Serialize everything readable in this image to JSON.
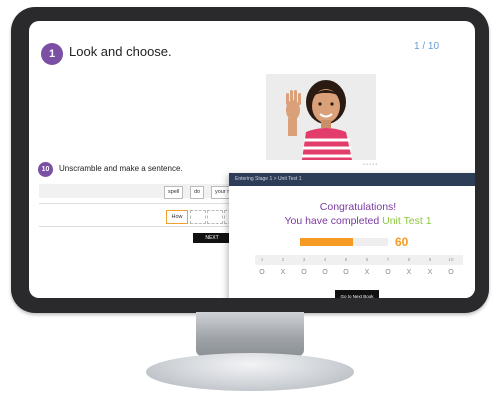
{
  "question1": {
    "number": "1",
    "title": "Look and choose."
  },
  "page_counter": "1 / 10",
  "question10": {
    "number": "10",
    "title": "Unscramble and make a sentence.",
    "word_bank": [
      "spell",
      "do",
      "your nam"
    ],
    "answer_first_word": "How",
    "next_label": "NEXT"
  },
  "popup": {
    "title": "Entering Stage 1 > Unit Test 1",
    "close_icon": "×",
    "congrats": "Congratulations!",
    "completed_prefix": "You have completed ",
    "unit_name": "Unit Test 1",
    "score": "60",
    "score_fraction": 0.6,
    "question_numbers": [
      "1",
      "2",
      "3",
      "4",
      "5",
      "6",
      "7",
      "8",
      "9",
      "10"
    ],
    "results": [
      "O",
      "X",
      "O",
      "O",
      "O",
      "X",
      "O",
      "X",
      "X",
      "O"
    ],
    "finish_label": "Go to Next Book"
  },
  "colors": {
    "accent_purple": "#7b4fa4",
    "title_purple": "#7b3aa0",
    "unit_green": "#8cc63f",
    "score_orange": "#f59a23",
    "header_navy": "#2e3d57"
  }
}
